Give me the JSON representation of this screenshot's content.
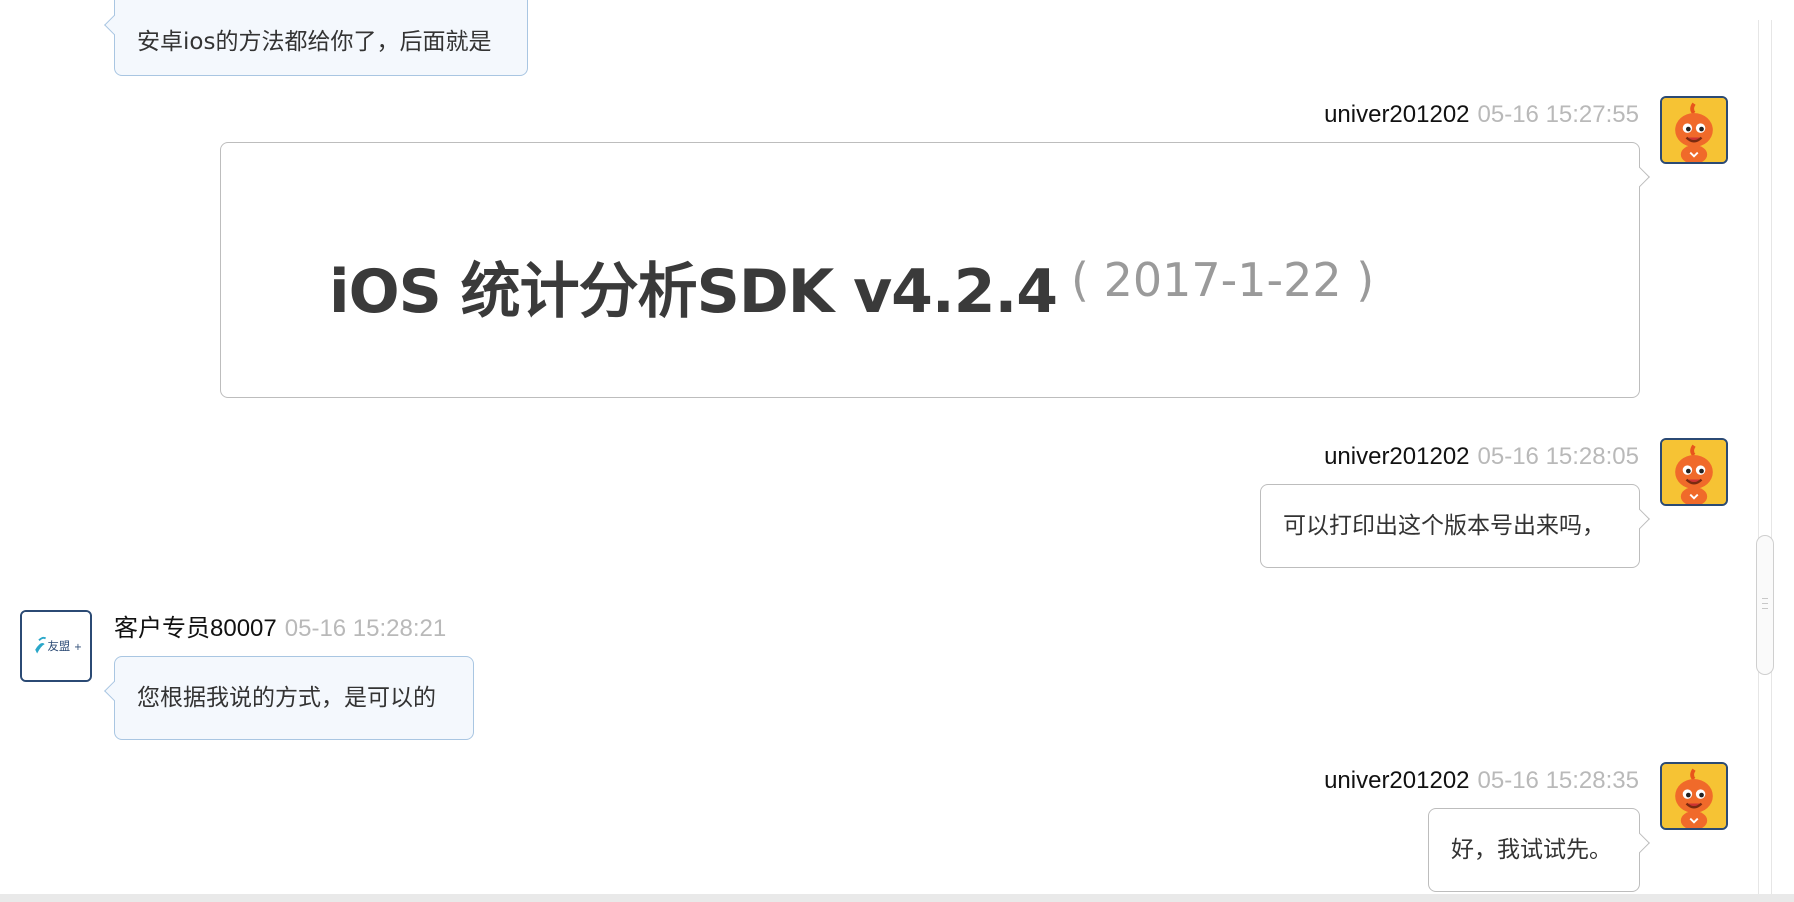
{
  "messages": [
    {
      "text": "安卓ios的方法都给你了，后面就是"
    },
    {
      "name": "univer201202",
      "time": "05-16 15:27:55",
      "image": {
        "title": "iOS 统计分析SDK v4.2.4",
        "date": "( 2017-1-22 )"
      }
    },
    {
      "name": "univer201202",
      "time": "05-16 15:28:05",
      "text": "可以打印出这个版本号出来吗，"
    },
    {
      "name": "客户专员80007",
      "time": "05-16 15:28:21",
      "text": "您根据我说的方式，是可以的"
    },
    {
      "name": "univer201202",
      "time": "05-16 15:28:35",
      "text": "好，我试试先。"
    }
  ],
  "agent_logo": {
    "text": "友盟",
    "plus": "+"
  },
  "icons": {
    "user_avatar": "orange-mascot-avatar-icon",
    "agent_avatar": "umeng-logo-icon"
  },
  "colors": {
    "incoming_bubble_bg": "#f4f8fd",
    "incoming_bubble_border": "#a9c6e2",
    "outgoing_bubble_border": "#bdbdbd",
    "timestamp": "#b9b9b9",
    "avatar_border": "#2b4a74"
  }
}
